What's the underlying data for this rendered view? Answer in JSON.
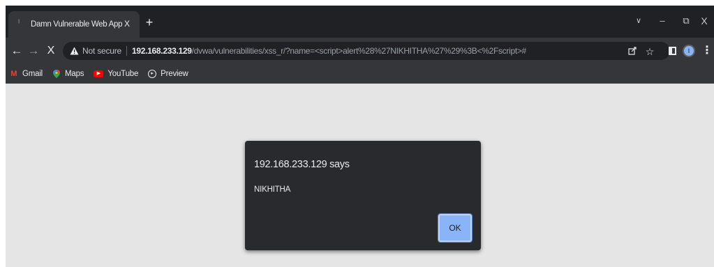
{
  "tab": {
    "title": "Damn Vulnerable Web App (DVW",
    "close_glyph": "X"
  },
  "window_controls": {
    "tab_search": "∨",
    "minimize": "–",
    "restore": "⧉",
    "close": "X"
  },
  "toolbar": {
    "back": "←",
    "forward": "→",
    "stop": "X",
    "security_label": "Not secure",
    "url_host": "192.168.233.129",
    "url_path": "/dvwa/vulnerabilities/xss_r/?name=<script>alert%28%27NIKHITHA%27%29%3B<%2Fscript>#",
    "profile_initial": "I"
  },
  "bookmarks": [
    {
      "label": "Gmail",
      "icon": "gmail-icon",
      "glyph": "M"
    },
    {
      "label": "Maps",
      "icon": "maps-icon",
      "glyph": "⬤"
    },
    {
      "label": "YouTube",
      "icon": "youtube-icon",
      "glyph": "▶"
    },
    {
      "label": "Preview",
      "icon": "preview-icon",
      "glyph": "▸"
    }
  ],
  "dialog": {
    "title": "192.168.233.129 says",
    "message": "NIKHITHA",
    "ok_label": "OK"
  },
  "colors": {
    "frame": "#202124",
    "toolbar": "#35363a",
    "page_background": "#e5e5e5",
    "dialog_background": "#292a2d",
    "accent": "#8ab4f8"
  }
}
